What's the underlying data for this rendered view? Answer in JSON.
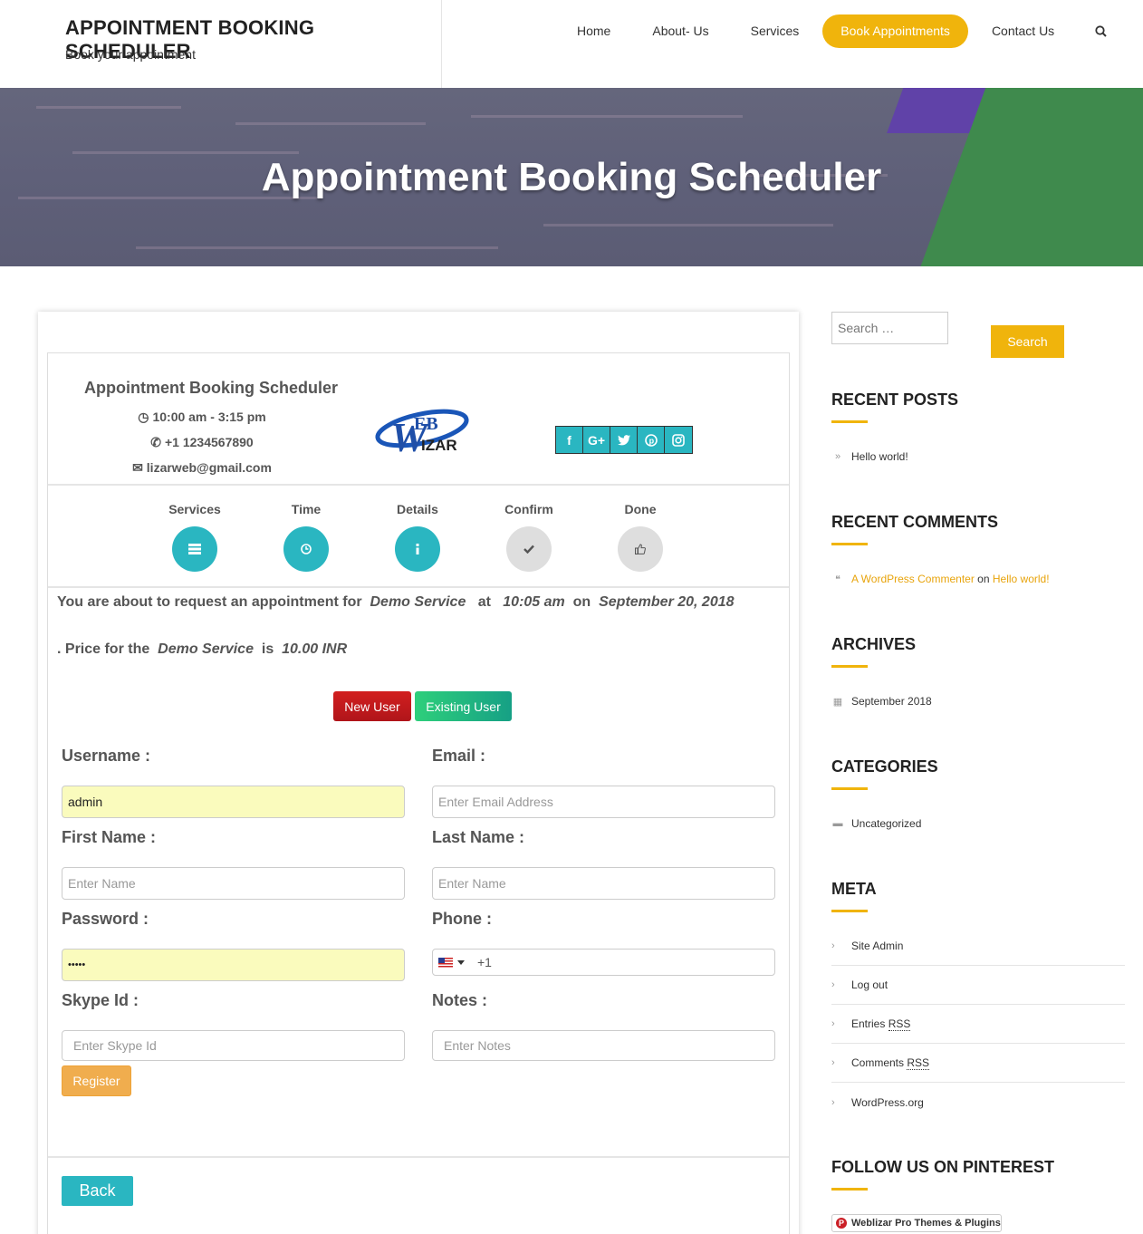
{
  "header": {
    "title": "APPOINTMENT BOOKING SCHEDULER",
    "tagline": "Book your appointment",
    "nav": [
      "Home",
      "About- Us",
      "Services",
      "Book Appointments",
      "Contact Us"
    ]
  },
  "hero": {
    "title": "Appointment Booking Scheduler"
  },
  "business": {
    "name": "Appointment Booking Scheduler",
    "hours": "10:00 am - 3:15 pm",
    "phone": "+1 1234567890",
    "email": "lizarweb@gmail.com",
    "logo_text_top": "EB",
    "logo_text_bottom": "IZAR",
    "logo_initials": "W"
  },
  "socials": [
    "f",
    "G+",
    "t",
    "p",
    "ig"
  ],
  "steps": [
    {
      "label": "Services",
      "state": "done"
    },
    {
      "label": "Time",
      "state": "done"
    },
    {
      "label": "Details",
      "state": "done"
    },
    {
      "label": "Confirm",
      "state": "pending"
    },
    {
      "label": "Done",
      "state": "pending"
    }
  ],
  "message": {
    "prefix": "You are about to request an appointment for",
    "service": "Demo Service",
    "at": "at",
    "time": "10:05 am",
    "on": "on",
    "date": "September 20, 2018",
    "price_prefix": ". Price for the",
    "price_service": "Demo Service",
    "is": "is",
    "price": "10.00 INR"
  },
  "user_buttons": {
    "new": "New User",
    "existing": "Existing User"
  },
  "form": {
    "username_label": "Username :",
    "username_value": "admin",
    "email_label": "Email :",
    "email_placeholder": "Enter Email Address",
    "first_label": "First Name :",
    "first_placeholder": "Enter Name",
    "last_label": "Last Name :",
    "last_placeholder": "Enter Name",
    "password_label": "Password :",
    "password_value": "•••••",
    "phone_label": "Phone :",
    "phone_value": "+1",
    "skype_label": "Skype Id :",
    "skype_placeholder": "Enter Skype Id",
    "notes_label": "Notes :",
    "notes_placeholder": "Enter Notes",
    "register": "Register"
  },
  "back": "Back",
  "sidebar": {
    "search_placeholder": "Search …",
    "search_button": "Search",
    "recent_posts_title": "RECENT POSTS",
    "recent_posts": [
      "Hello world!"
    ],
    "recent_comments_title": "RECENT COMMENTS",
    "comment_author": "A WordPress Commenter",
    "comment_on": "on",
    "comment_post": "Hello world!",
    "archives_title": "ARCHIVES",
    "archives": [
      "September 2018"
    ],
    "categories_title": "CATEGORIES",
    "categories": [
      "Uncategorized"
    ],
    "meta_title": "META",
    "meta": {
      "site_admin": "Site Admin",
      "log_out": "Log out",
      "entries": "Entries",
      "comments": "Comments",
      "rss": "RSS",
      "wordpress": "WordPress.org"
    },
    "pinterest_title": "FOLLOW US ON PINTEREST",
    "pinterest_button": "Weblizar Pro Themes & Plugins"
  },
  "colors": {
    "accent": "#f0b40c",
    "teal": "#2ab6c1",
    "danger": "#c81b1e",
    "success": "#16a085"
  }
}
